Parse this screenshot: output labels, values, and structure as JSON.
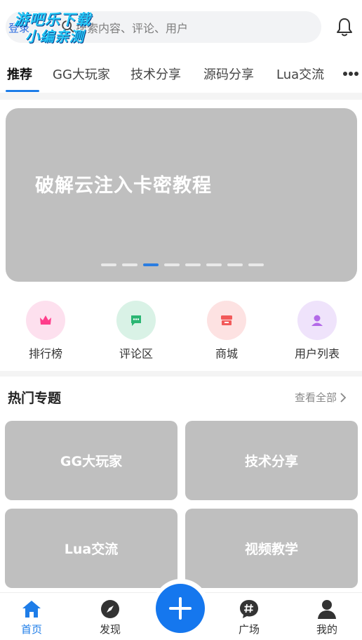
{
  "watermark": {
    "line1": "游吧乐下载",
    "line2": "小编亲测"
  },
  "header": {
    "login": "登录",
    "search_placeholder": "搜索内容、评论、用户"
  },
  "tabs": [
    {
      "label": "推荐",
      "active": true
    },
    {
      "label": "GG大玩家"
    },
    {
      "label": "技术分享"
    },
    {
      "label": "源码分享"
    },
    {
      "label": "Lua交流"
    }
  ],
  "banner": {
    "title": "破解云注入卡密教程",
    "slide_count": 8,
    "active_slide": 3
  },
  "quick_entries": [
    {
      "label": "排行榜",
      "icon": "crown-icon",
      "bg": "#fde0ee",
      "fg": "#ff3d8b"
    },
    {
      "label": "评论区",
      "icon": "comment-icon",
      "bg": "#d9f2e6",
      "fg": "#2bb673"
    },
    {
      "label": "商城",
      "icon": "shop-icon",
      "bg": "#fde2e2",
      "fg": "#f25a5a"
    },
    {
      "label": "用户列表",
      "icon": "user-icon",
      "bg": "#efe3fb",
      "fg": "#b36ae8"
    }
  ],
  "topics": {
    "title": "热门专题",
    "see_all": "查看全部",
    "items": [
      {
        "label": "GG大玩家"
      },
      {
        "label": "技术分享"
      },
      {
        "label": "Lua交流"
      },
      {
        "label": "视频教学"
      }
    ]
  },
  "bottom_nav": [
    {
      "label": "首页",
      "icon": "home-icon",
      "active": true
    },
    {
      "label": "发现",
      "icon": "compass-icon"
    },
    {
      "label": "广场",
      "icon": "hashtag-icon"
    },
    {
      "label": "我的",
      "icon": "profile-icon"
    }
  ],
  "colors": {
    "accent": "#1e7de8",
    "card_bg": "#bfbfbf"
  }
}
